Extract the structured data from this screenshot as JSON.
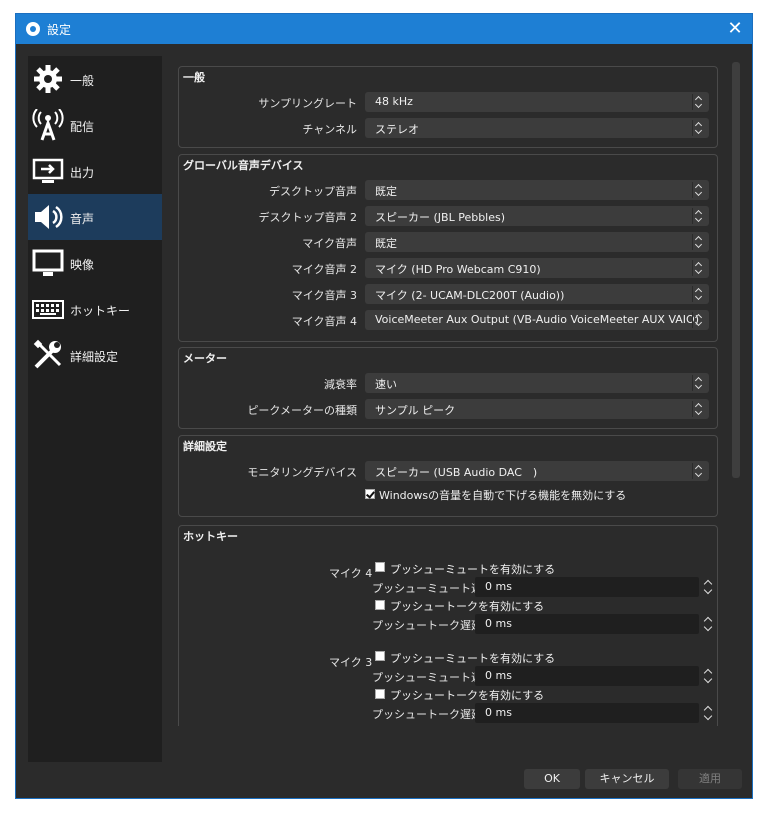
{
  "window": {
    "title": "設定",
    "close_label": "✕"
  },
  "sidebar": {
    "items": [
      {
        "label": "一般",
        "icon": "gear-icon",
        "active": false
      },
      {
        "label": "配信",
        "icon": "broadcast-icon",
        "active": false
      },
      {
        "label": "出力",
        "icon": "output-icon",
        "active": false
      },
      {
        "label": "音声",
        "icon": "speaker-icon",
        "active": true
      },
      {
        "label": "映像",
        "icon": "monitor-icon",
        "active": false
      },
      {
        "label": "ホットキー",
        "icon": "keyboard-icon",
        "active": false
      },
      {
        "label": "詳細設定",
        "icon": "tools-icon",
        "active": false
      }
    ]
  },
  "general": {
    "title": "一般",
    "sample_rate_label": "サンプリングレート",
    "sample_rate_value": "48 kHz",
    "channel_label": "チャンネル",
    "channel_value": "ステレオ"
  },
  "global_devices": {
    "title": "グローバル音声デバイス",
    "rows": [
      {
        "label": "デスクトップ音声",
        "value": "既定"
      },
      {
        "label": "デスクトップ音声 2",
        "value": "スピーカー (JBL Pebbles)"
      },
      {
        "label": "マイク音声",
        "value": "既定"
      },
      {
        "label": "マイク音声 2",
        "value": "マイク (HD Pro Webcam C910)"
      },
      {
        "label": "マイク音声 3",
        "value": "マイク (2- UCAM-DLC200T (Audio))"
      },
      {
        "label": "マイク音声 4",
        "value": "VoiceMeeter Aux Output (VB-Audio VoiceMeeter AUX VAIO)"
      }
    ]
  },
  "meters": {
    "title": "メーター",
    "decay_label": "減衰率",
    "decay_value": "速い",
    "peak_label": "ピークメーターの種類",
    "peak_value": "サンプル ピーク"
  },
  "advanced": {
    "title": "詳細設定",
    "monitor_label": "モニタリングデバイス",
    "monitor_value": "スピーカー (USB Audio DAC　)",
    "ducking_label": "Windowsの音量を自動で下げる機能を無効にする",
    "ducking_checked": true
  },
  "hotkeys": {
    "title": "ホットキー",
    "sources": [
      {
        "name": "マイク 4",
        "push_mute_label": "プッシューミュートを有効にする",
        "push_mute_delay_label": "プッシューミュート遅延",
        "push_mute_delay_value": "0 ms",
        "push_talk_label": "プッシュートークを有効にする",
        "push_talk_delay_label": "プッシュートーク遅延",
        "push_talk_delay_value": "0 ms"
      },
      {
        "name": "マイク 3",
        "push_mute_label": "プッシューミュートを有効にする",
        "push_mute_delay_label": "プッシューミュート遅延",
        "push_mute_delay_value": "0 ms",
        "push_talk_label": "プッシュートークを有効にする",
        "push_talk_delay_label": "プッシュートーク遅延",
        "push_talk_delay_value": "0 ms"
      }
    ]
  },
  "footer": {
    "ok_label": "OK",
    "cancel_label": "キャンセル",
    "apply_label": "適用"
  }
}
